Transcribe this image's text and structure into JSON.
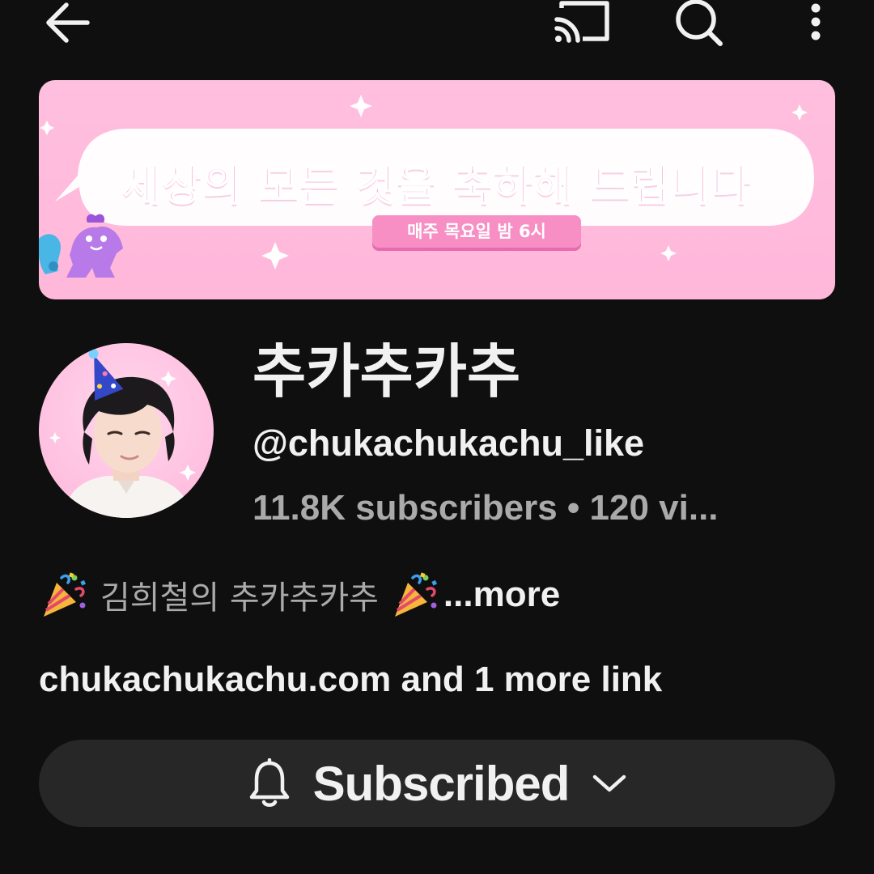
{
  "topbar": {
    "icons": [
      "back-arrow-icon",
      "cast-icon",
      "search-icon",
      "more-vert-icon"
    ]
  },
  "banner": {
    "headline": "세상의 모든 것을 축하해 드립니다",
    "schedule": "매주 목요일 밤 6시",
    "colors": {
      "background": "#ffbfdf",
      "accent": "#f78fc4"
    }
  },
  "channel": {
    "name": "추카추카추",
    "handle": "@chukachukachu_like",
    "stats": "11.8K subscribers • 120 vi..."
  },
  "description": {
    "text": "김희철의 추카추카추",
    "emoji": "party-popper-icon",
    "more_label": "...more"
  },
  "links": {
    "primary": "chukachukachu.com",
    "extra": "and 1 more link"
  },
  "subscribe": {
    "label": "Subscribed",
    "icons": [
      "bell-icon",
      "chevron-down-icon"
    ]
  },
  "colors": {
    "page_bg": "#0f0f0f",
    "text_primary": "#f1f1f1",
    "text_secondary": "#aaaaaa",
    "button_bg": "#272727"
  }
}
